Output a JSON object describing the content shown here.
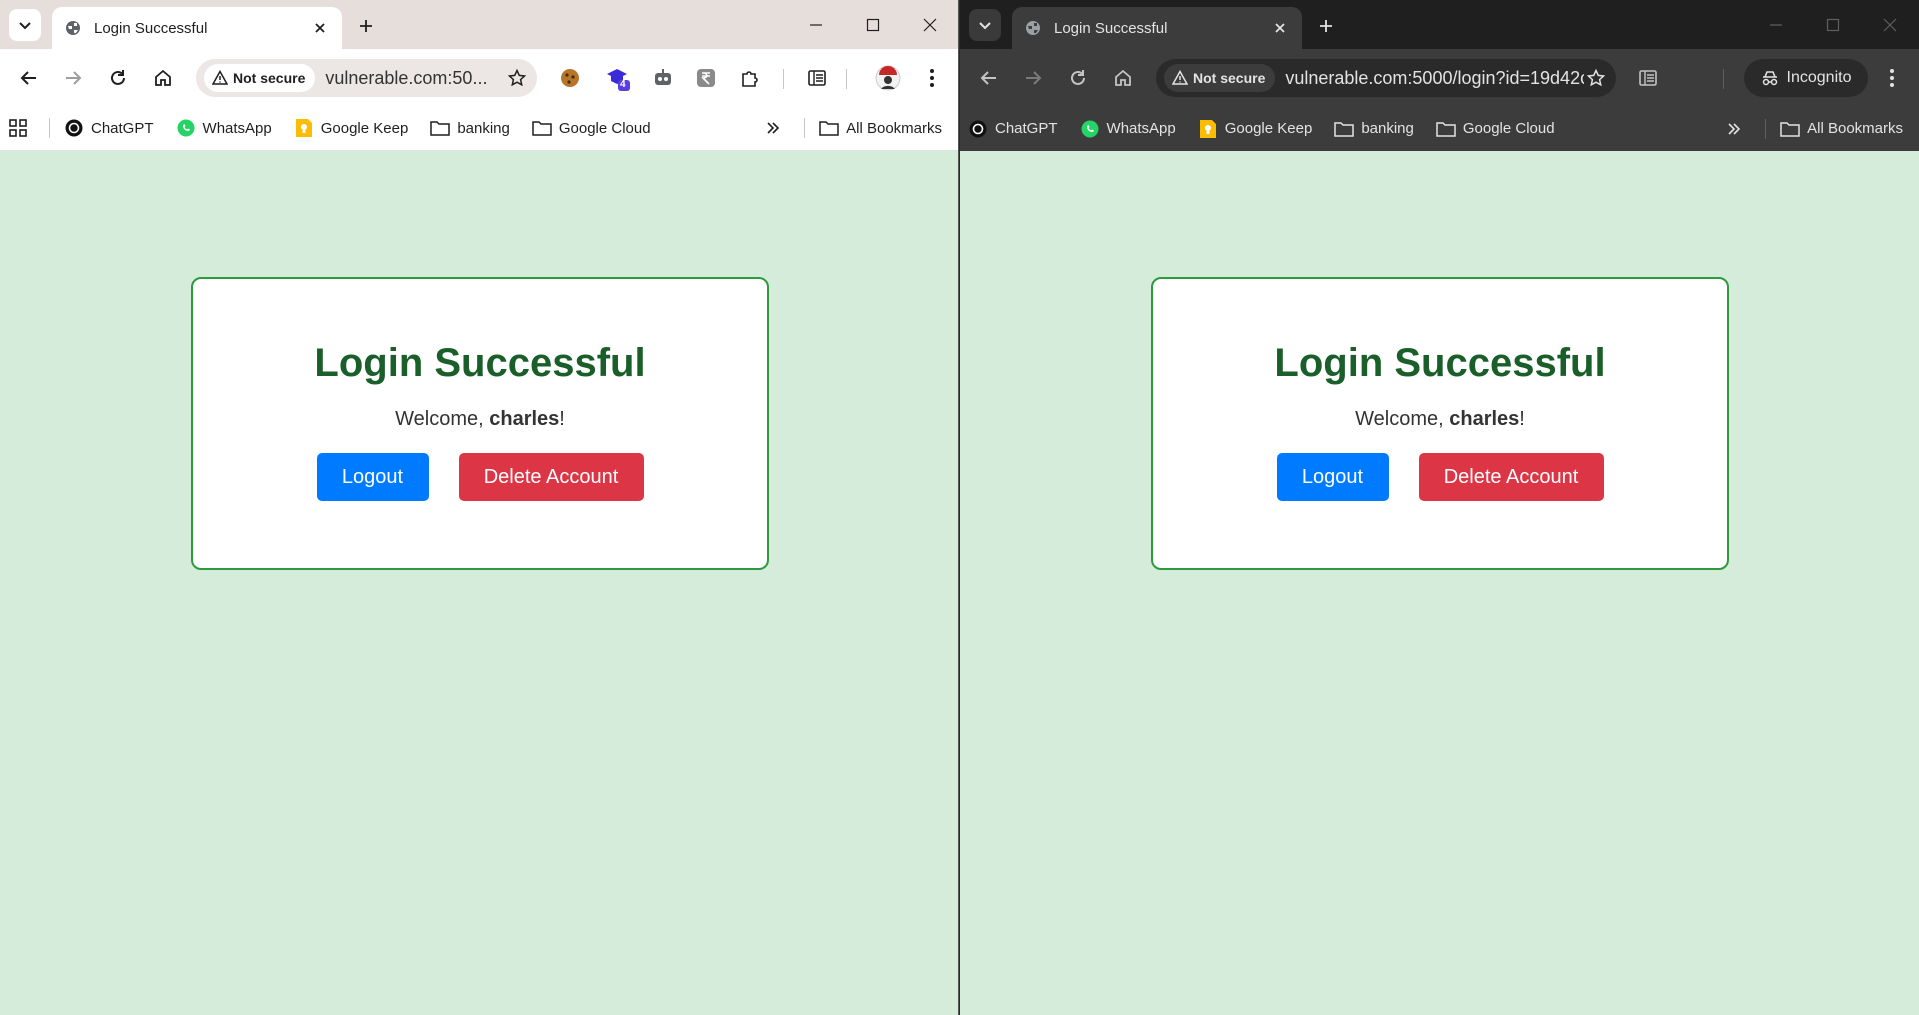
{
  "windows": [
    {
      "id": "left",
      "tab_title": "Login Successful",
      "security_label": "Not secure",
      "url": "vulnerable.com:50...",
      "bookmarks": [
        "ChatGPT",
        "WhatsApp",
        "Google Keep",
        "banking",
        "Google Cloud"
      ],
      "all_bookmarks": "All Bookmarks",
      "extension_badge": "4",
      "page": {
        "heading": "Login Successful",
        "welcome_prefix": "Welcome, ",
        "username": "charles",
        "welcome_suffix": "!",
        "logout_label": "Logout",
        "delete_label": "Delete Account"
      }
    },
    {
      "id": "right",
      "tab_title": "Login Successful",
      "security_label": "Not secure",
      "url": "vulnerable.com:5000/login?id=19d42c...",
      "incognito_label": "Incognito",
      "bookmarks": [
        "ChatGPT",
        "WhatsApp",
        "Google Keep",
        "banking",
        "Google Cloud"
      ],
      "all_bookmarks": "All Bookmarks",
      "page": {
        "heading": "Login Successful",
        "welcome_prefix": "Welcome, ",
        "username": "charles",
        "welcome_suffix": "!",
        "logout_label": "Logout",
        "delete_label": "Delete Account"
      }
    }
  ],
  "colors": {
    "page_bg": "#d4ecd9",
    "heading": "#1a5e2a",
    "card_border": "#2d9a3e",
    "logout_btn": "#007bff",
    "delete_btn": "#dc3545"
  }
}
